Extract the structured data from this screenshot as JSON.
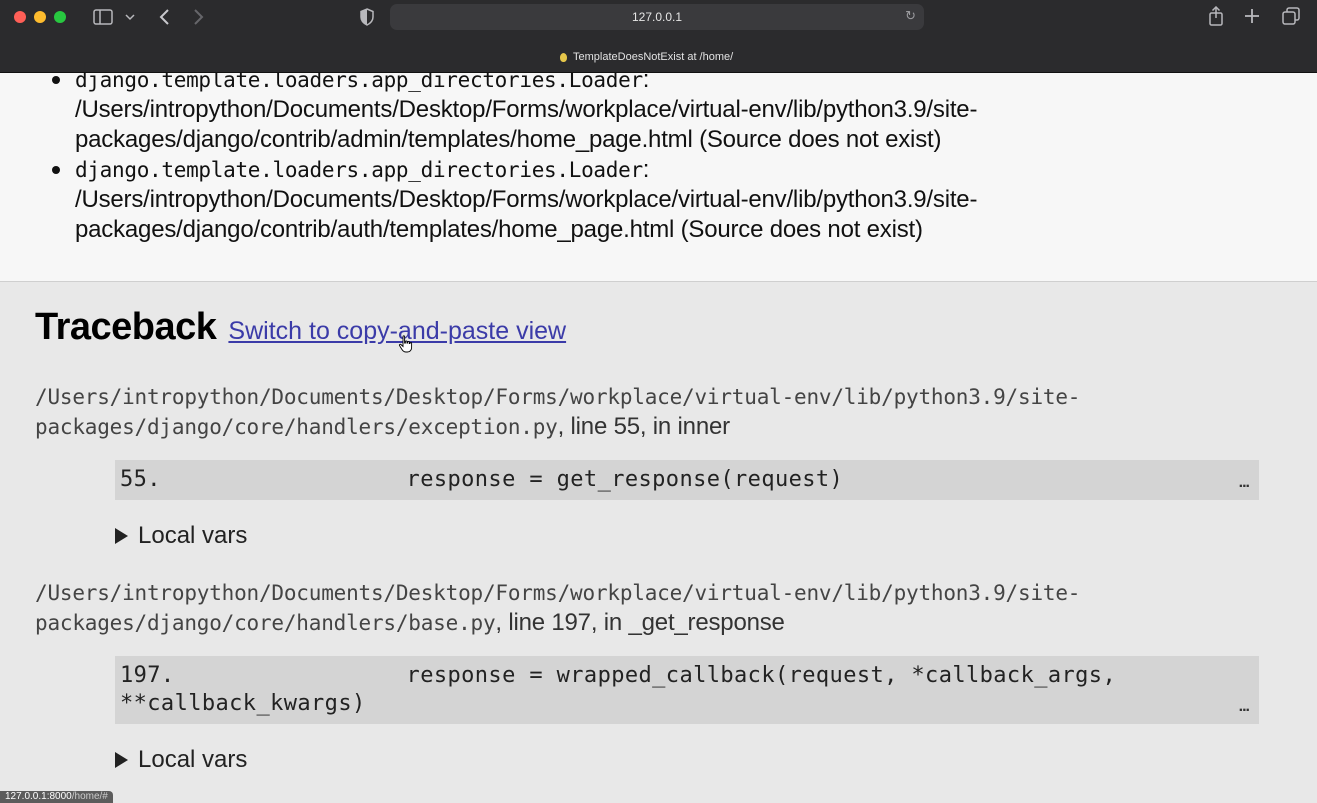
{
  "browser": {
    "url": "127.0.0.1",
    "tab_title": "TemplateDoesNotExist at /home/",
    "status_url_host": "127.0.0.1:8000",
    "status_url_path": "/home/#",
    "icons": {
      "sidebar": "sidebar-icon",
      "chevron_down": "chevron-down-icon",
      "back": "back-icon",
      "forward": "forward-icon",
      "shield": "shield-icon",
      "reload": "reload-icon",
      "share": "share-icon",
      "new_tab": "plus-icon",
      "tab_overview": "tabs-icon"
    }
  },
  "loaders": [
    {
      "loader": "django.template.loaders.app_directories.Loader",
      "sep": ":",
      "path": "/Users/intropython/Documents/Desktop/Forms/workplace/virtual-env/lib/python3.9/site-packages/django/contrib/admin/templates/home_page.html",
      "note": "(Source does not exist)"
    },
    {
      "loader": "django.template.loaders.app_directories.Loader",
      "sep": ":",
      "path": "/Users/intropython/Documents/Desktop/Forms/workplace/virtual-env/lib/python3.9/site-packages/django/contrib/auth/templates/home_page.html",
      "note": "(Source does not exist)"
    }
  ],
  "traceback": {
    "title": "Traceback",
    "switch_link": "Switch to copy-and-paste view",
    "frames": [
      {
        "path_line1": "/Users/intropython/Documents/Desktop/Forms/workplace/virtual-env/lib/python3.9/site-",
        "path_line2": "packages/django/core/handlers/exception.py",
        "location": ", line 55, in inner",
        "code": "55.                  response = get_response(request)",
        "ellipsis": "...",
        "local_vars": "Local vars"
      },
      {
        "path_line1": "/Users/intropython/Documents/Desktop/Forms/workplace/virtual-env/lib/python3.9/site-",
        "path_line2": "packages/django/core/handlers/base.py",
        "location": ", line 197, in _get_response",
        "code": "197.                 response = wrapped_callback(request, *callback_args,\n**callback_kwargs)",
        "ellipsis": "...",
        "local_vars": "Local vars"
      }
    ]
  },
  "colors": {
    "chrome_bg": "#2b2b2d",
    "link": "#3b3ba8",
    "code_bg": "#d4d4d4",
    "section_bg": "#e8e8e8"
  }
}
